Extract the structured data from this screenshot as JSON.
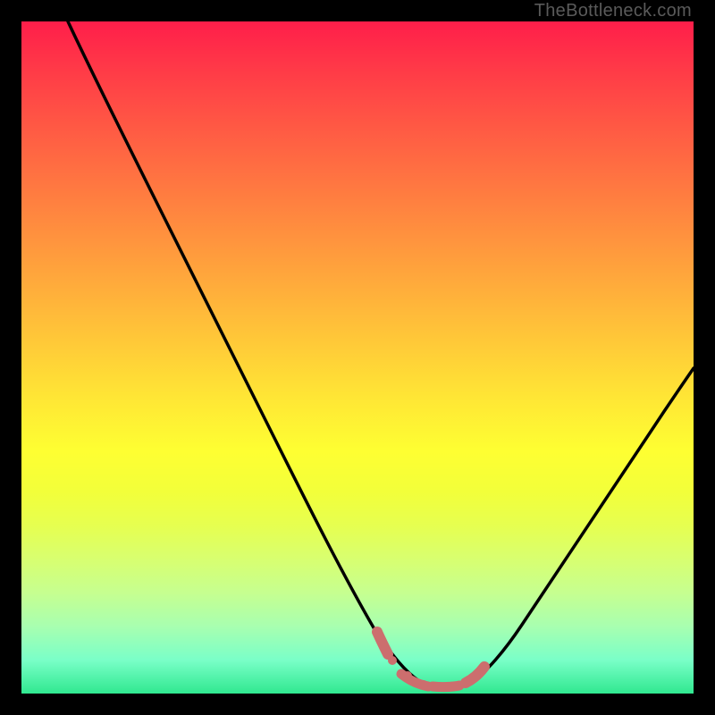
{
  "watermark": "TheBottleneck.com",
  "chart_data": {
    "type": "line",
    "title": "",
    "xlabel": "",
    "ylabel": "",
    "xlim": [
      0,
      100
    ],
    "ylim": [
      0,
      100
    ],
    "series": [
      {
        "name": "curve",
        "x": [
          7,
          12,
          18,
          24,
          30,
          36,
          42,
          48,
          52,
          55,
          57,
          59,
          61,
          63,
          65,
          67,
          70,
          75,
          80,
          85,
          90,
          95,
          100
        ],
        "y": [
          100,
          92,
          82,
          72,
          62,
          52,
          42,
          32,
          22,
          14,
          8,
          4,
          2,
          1,
          1,
          2,
          5,
          12,
          20,
          28,
          36,
          44,
          52
        ],
        "color": "#000000"
      },
      {
        "name": "bottom-highlight",
        "x": [
          52,
          54,
          56,
          58,
          60,
          62,
          64,
          66,
          68
        ],
        "y": [
          7,
          4,
          2,
          1,
          1,
          1,
          2,
          4,
          7
        ],
        "color": "#d96a6a"
      }
    ],
    "gradient_bg": {
      "type": "vertical",
      "stops": [
        {
          "pos": 0,
          "color": "#ff1e4a"
        },
        {
          "pos": 50,
          "color": "#ffd038"
        },
        {
          "pos": 100,
          "color": "#30e890"
        }
      ]
    }
  }
}
